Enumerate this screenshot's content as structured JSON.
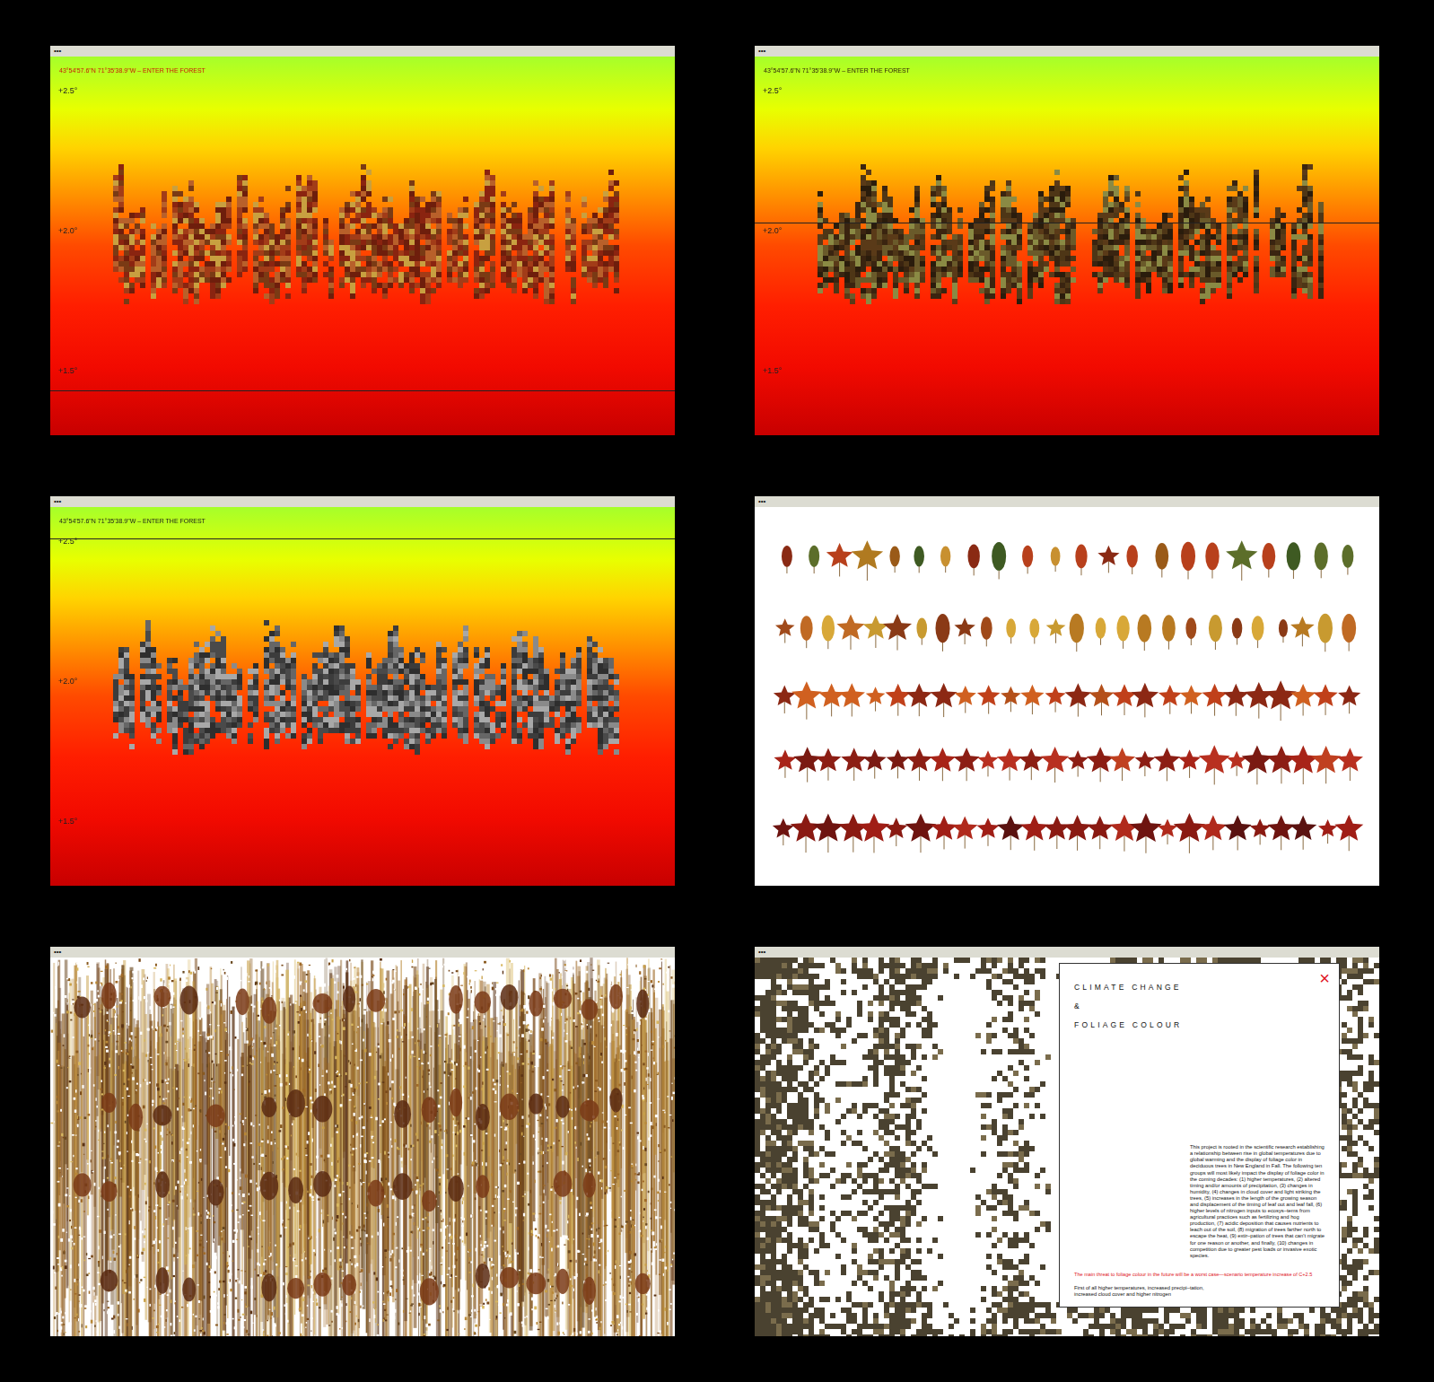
{
  "windows": [
    {
      "kind": "forest",
      "title_dots": "•••",
      "header": "43°54'57.6\"N 71°35'38.9\"W – ENTER THE FOREST",
      "header_color": "#c8140a",
      "ticks": [
        {
          "label": "+2.5°",
          "value": 2.5
        },
        {
          "label": "+2.0°",
          "value": 2.0
        },
        {
          "label": "+1.5°",
          "value": 1.5
        }
      ],
      "marker_value": 1.43,
      "tree_colors": [
        "#8a2410",
        "#a23c18",
        "#6e1e0c",
        "#b8602a",
        "#c8a040",
        "#7a3a14"
      ]
    },
    {
      "kind": "forest",
      "title_dots": "•••",
      "header": "43°54'57.6\"N 71°35'38.9\"W – ENTER THE FOREST",
      "header_color": "#2a1a0a",
      "ticks": [
        {
          "label": "+2.5°",
          "value": 2.5
        },
        {
          "label": "+2.0°",
          "value": 2.0
        },
        {
          "label": "+1.5°",
          "value": 1.5
        }
      ],
      "marker_value": 2.03,
      "tree_colors": [
        "#3a2410",
        "#4e3616",
        "#2a1c0c",
        "#6a5a2a",
        "#8a8a44",
        "#5a3a18"
      ]
    },
    {
      "kind": "forest",
      "title_dots": "•••",
      "header": "43°54'57.6\"N 71°35'38.9\"W – ENTER THE FOREST",
      "header_color": "#1a1a1a",
      "ticks": [
        {
          "label": "+2.5°",
          "value": 2.5
        },
        {
          "label": "+2.0°",
          "value": 2.0
        },
        {
          "label": "+1.5°",
          "value": 1.5
        }
      ],
      "marker_value": 2.51,
      "tree_colors": [
        "#2e2e2e",
        "#4a4a4a",
        "#666666",
        "#8a8a8a",
        "#a8a8a8",
        "#3c3c3c"
      ]
    },
    {
      "kind": "leaves",
      "title_dots": "•••"
    },
    {
      "kind": "streaks",
      "title_dots": "•••"
    },
    {
      "kind": "article",
      "title_dots": "•••",
      "title_lines": [
        "CLIMATE CHANGE",
        "&",
        "FOLIAGE COLOUR"
      ],
      "close": "×",
      "body": "This project is rooted in the scientific research establishing a relationship between rise in global temperatures due to global warming and the display of foliage color in deciduous trees in New England in Fall. The following ten groups will most likely impact the display of foliage color in the coming decades: (1) higher temperatures, (2) altered timing and/or amounts of precipitation, (3) changes in humidity, (4) changes in cloud cover and light striking the trees, (5) increases in the length of the growing season and displacement of the timing of leaf out and leaf fall, (6) higher levels of nitrogen inputs to ecosys–tems from agricultural practices such as fertilizing and hog production, (7) acidic deposition that causes nutrients to leach out of the soil, (8) migration of trees farther north to escape the heat, (9) extir–pation of trees that can't migrate for one reason or another, and finally, (10) changes in competition due to greater pest loads or invasive exotic species.",
      "highlight": "The main threat to foliage colour in the future will be a worst case—scenario temperature increase of C+2.5",
      "continuation": "First of all higher temperatures, increased precipi–tation, increased cloud cover and higher nitrogen"
    }
  ]
}
